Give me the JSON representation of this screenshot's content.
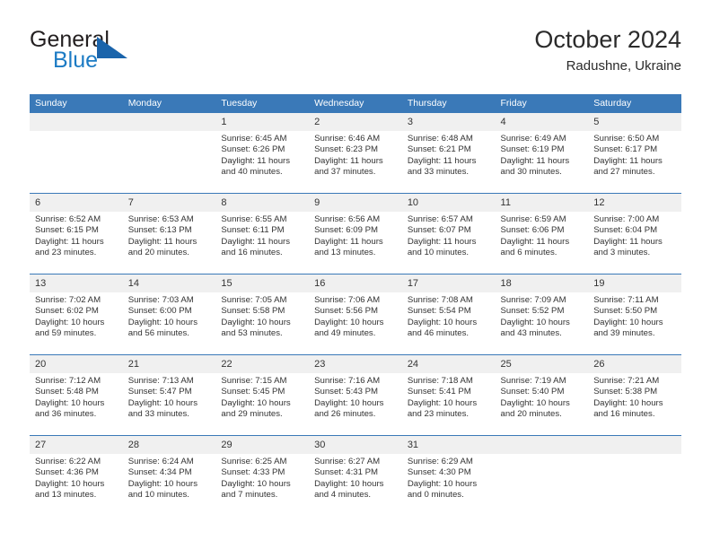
{
  "logo": {
    "word_top": "General",
    "word_bottom": "Blue",
    "triangle_color": "#1a64ab",
    "blue_color": "#1c7bc4"
  },
  "header": {
    "title": "October 2024",
    "subtitle": "Radushne, Ukraine"
  },
  "theme": {
    "header_bg": "#3a79b8",
    "daynum_bg": "#f0f0f0",
    "text": "#333333"
  },
  "weekday_headers": [
    "Sunday",
    "Monday",
    "Tuesday",
    "Wednesday",
    "Thursday",
    "Friday",
    "Saturday"
  ],
  "weeks": [
    [
      {
        "day": "",
        "sunrise": "",
        "sunset": "",
        "daylight": "",
        "blank": true
      },
      {
        "day": "",
        "sunrise": "",
        "sunset": "",
        "daylight": "",
        "blank": true
      },
      {
        "day": "1",
        "sunrise": "Sunrise: 6:45 AM",
        "sunset": "Sunset: 6:26 PM",
        "daylight": "Daylight: 11 hours and 40 minutes."
      },
      {
        "day": "2",
        "sunrise": "Sunrise: 6:46 AM",
        "sunset": "Sunset: 6:23 PM",
        "daylight": "Daylight: 11 hours and 37 minutes."
      },
      {
        "day": "3",
        "sunrise": "Sunrise: 6:48 AM",
        "sunset": "Sunset: 6:21 PM",
        "daylight": "Daylight: 11 hours and 33 minutes."
      },
      {
        "day": "4",
        "sunrise": "Sunrise: 6:49 AM",
        "sunset": "Sunset: 6:19 PM",
        "daylight": "Daylight: 11 hours and 30 minutes."
      },
      {
        "day": "5",
        "sunrise": "Sunrise: 6:50 AM",
        "sunset": "Sunset: 6:17 PM",
        "daylight": "Daylight: 11 hours and 27 minutes."
      }
    ],
    [
      {
        "day": "6",
        "sunrise": "Sunrise: 6:52 AM",
        "sunset": "Sunset: 6:15 PM",
        "daylight": "Daylight: 11 hours and 23 minutes."
      },
      {
        "day": "7",
        "sunrise": "Sunrise: 6:53 AM",
        "sunset": "Sunset: 6:13 PM",
        "daylight": "Daylight: 11 hours and 20 minutes."
      },
      {
        "day": "8",
        "sunrise": "Sunrise: 6:55 AM",
        "sunset": "Sunset: 6:11 PM",
        "daylight": "Daylight: 11 hours and 16 minutes."
      },
      {
        "day": "9",
        "sunrise": "Sunrise: 6:56 AM",
        "sunset": "Sunset: 6:09 PM",
        "daylight": "Daylight: 11 hours and 13 minutes."
      },
      {
        "day": "10",
        "sunrise": "Sunrise: 6:57 AM",
        "sunset": "Sunset: 6:07 PM",
        "daylight": "Daylight: 11 hours and 10 minutes."
      },
      {
        "day": "11",
        "sunrise": "Sunrise: 6:59 AM",
        "sunset": "Sunset: 6:06 PM",
        "daylight": "Daylight: 11 hours and 6 minutes."
      },
      {
        "day": "12",
        "sunrise": "Sunrise: 7:00 AM",
        "sunset": "Sunset: 6:04 PM",
        "daylight": "Daylight: 11 hours and 3 minutes."
      }
    ],
    [
      {
        "day": "13",
        "sunrise": "Sunrise: 7:02 AM",
        "sunset": "Sunset: 6:02 PM",
        "daylight": "Daylight: 10 hours and 59 minutes."
      },
      {
        "day": "14",
        "sunrise": "Sunrise: 7:03 AM",
        "sunset": "Sunset: 6:00 PM",
        "daylight": "Daylight: 10 hours and 56 minutes."
      },
      {
        "day": "15",
        "sunrise": "Sunrise: 7:05 AM",
        "sunset": "Sunset: 5:58 PM",
        "daylight": "Daylight: 10 hours and 53 minutes."
      },
      {
        "day": "16",
        "sunrise": "Sunrise: 7:06 AM",
        "sunset": "Sunset: 5:56 PM",
        "daylight": "Daylight: 10 hours and 49 minutes."
      },
      {
        "day": "17",
        "sunrise": "Sunrise: 7:08 AM",
        "sunset": "Sunset: 5:54 PM",
        "daylight": "Daylight: 10 hours and 46 minutes."
      },
      {
        "day": "18",
        "sunrise": "Sunrise: 7:09 AM",
        "sunset": "Sunset: 5:52 PM",
        "daylight": "Daylight: 10 hours and 43 minutes."
      },
      {
        "day": "19",
        "sunrise": "Sunrise: 7:11 AM",
        "sunset": "Sunset: 5:50 PM",
        "daylight": "Daylight: 10 hours and 39 minutes."
      }
    ],
    [
      {
        "day": "20",
        "sunrise": "Sunrise: 7:12 AM",
        "sunset": "Sunset: 5:48 PM",
        "daylight": "Daylight: 10 hours and 36 minutes."
      },
      {
        "day": "21",
        "sunrise": "Sunrise: 7:13 AM",
        "sunset": "Sunset: 5:47 PM",
        "daylight": "Daylight: 10 hours and 33 minutes."
      },
      {
        "day": "22",
        "sunrise": "Sunrise: 7:15 AM",
        "sunset": "Sunset: 5:45 PM",
        "daylight": "Daylight: 10 hours and 29 minutes."
      },
      {
        "day": "23",
        "sunrise": "Sunrise: 7:16 AM",
        "sunset": "Sunset: 5:43 PM",
        "daylight": "Daylight: 10 hours and 26 minutes."
      },
      {
        "day": "24",
        "sunrise": "Sunrise: 7:18 AM",
        "sunset": "Sunset: 5:41 PM",
        "daylight": "Daylight: 10 hours and 23 minutes."
      },
      {
        "day": "25",
        "sunrise": "Sunrise: 7:19 AM",
        "sunset": "Sunset: 5:40 PM",
        "daylight": "Daylight: 10 hours and 20 minutes."
      },
      {
        "day": "26",
        "sunrise": "Sunrise: 7:21 AM",
        "sunset": "Sunset: 5:38 PM",
        "daylight": "Daylight: 10 hours and 16 minutes."
      }
    ],
    [
      {
        "day": "27",
        "sunrise": "Sunrise: 6:22 AM",
        "sunset": "Sunset: 4:36 PM",
        "daylight": "Daylight: 10 hours and 13 minutes."
      },
      {
        "day": "28",
        "sunrise": "Sunrise: 6:24 AM",
        "sunset": "Sunset: 4:34 PM",
        "daylight": "Daylight: 10 hours and 10 minutes."
      },
      {
        "day": "29",
        "sunrise": "Sunrise: 6:25 AM",
        "sunset": "Sunset: 4:33 PM",
        "daylight": "Daylight: 10 hours and 7 minutes."
      },
      {
        "day": "30",
        "sunrise": "Sunrise: 6:27 AM",
        "sunset": "Sunset: 4:31 PM",
        "daylight": "Daylight: 10 hours and 4 minutes."
      },
      {
        "day": "31",
        "sunrise": "Sunrise: 6:29 AM",
        "sunset": "Sunset: 4:30 PM",
        "daylight": "Daylight: 10 hours and 0 minutes."
      },
      {
        "day": "",
        "sunrise": "",
        "sunset": "",
        "daylight": "",
        "blank": true
      },
      {
        "day": "",
        "sunrise": "",
        "sunset": "",
        "daylight": "",
        "blank": true
      }
    ]
  ]
}
